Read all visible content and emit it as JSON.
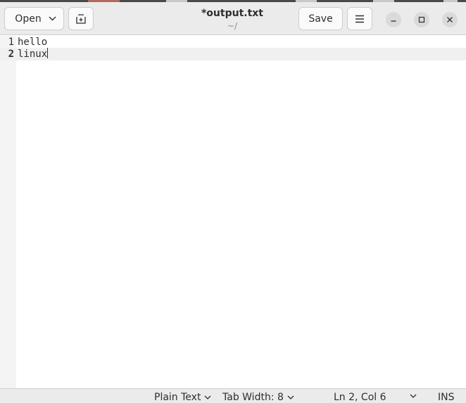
{
  "header": {
    "open_label": "Open",
    "save_label": "Save",
    "title": "*output.txt",
    "subtitle": "~/"
  },
  "editor": {
    "lines": [
      {
        "number": "1",
        "text": "hello"
      },
      {
        "number": "2",
        "text": "linux"
      }
    ]
  },
  "statusbar": {
    "language": "Plain Text",
    "tab_width": "Tab Width: 8",
    "position": "Ln 2, Col 6",
    "mode": "INS"
  }
}
